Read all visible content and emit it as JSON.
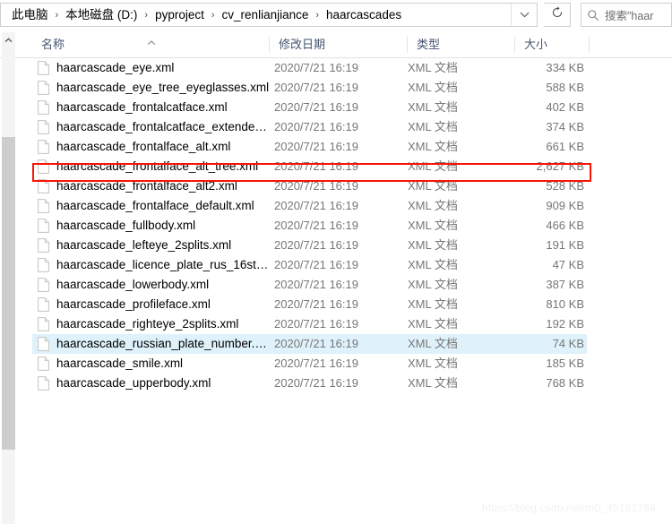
{
  "window": {
    "app": "File Explorer"
  },
  "addressbar": {
    "crumbs": [
      "此电脑",
      "本地磁盘 (D:)",
      "pyproject",
      "cv_renlianjiance",
      "haarcascades"
    ],
    "separator": "›",
    "dropdown_icon": "chevron-down-icon",
    "refresh_icon": "refresh-icon"
  },
  "search": {
    "icon": "search-icon",
    "value": "搜索\"haar"
  },
  "columns": {
    "headers": [
      "名称",
      "修改日期",
      "类型",
      "大小"
    ],
    "sorted_by": "名称",
    "sort_direction": "ascending",
    "sort_icon": "caret-up-icon"
  },
  "scrollbar": {
    "up_icon": "caret-up-icon",
    "orientation": "vertical"
  },
  "annotation": {
    "color": "#fb1304",
    "target_row_index": 5
  },
  "watermark": {
    "text": "https://blog.csdn.net/m0_45161766"
  },
  "files": [
    {
      "icon": "xml-file-icon",
      "name": "haarcascade_eye.xml",
      "date": "2020/7/21 16:19",
      "type": "XML 文档",
      "size": "334 KB",
      "hovered": false
    },
    {
      "icon": "xml-file-icon",
      "name": "haarcascade_eye_tree_eyeglasses.xml",
      "date": "2020/7/21 16:19",
      "type": "XML 文档",
      "size": "588 KB",
      "hovered": false
    },
    {
      "icon": "xml-file-icon",
      "name": "haarcascade_frontalcatface.xml",
      "date": "2020/7/21 16:19",
      "type": "XML 文档",
      "size": "402 KB",
      "hovered": false
    },
    {
      "icon": "xml-file-icon",
      "name": "haarcascade_frontalcatface_extende…",
      "date": "2020/7/21 16:19",
      "type": "XML 文档",
      "size": "374 KB",
      "hovered": false
    },
    {
      "icon": "xml-file-icon",
      "name": "haarcascade_frontalface_alt.xml",
      "date": "2020/7/21 16:19",
      "type": "XML 文档",
      "size": "661 KB",
      "hovered": false
    },
    {
      "icon": "xml-file-icon",
      "name": "haarcascade_frontalface_alt_tree.xml",
      "date": "2020/7/21 16:19",
      "type": "XML 文档",
      "size": "2,627 KB",
      "hovered": false
    },
    {
      "icon": "xml-file-icon",
      "name": "haarcascade_frontalface_alt2.xml",
      "date": "2020/7/21 16:19",
      "type": "XML 文档",
      "size": "528 KB",
      "hovered": false
    },
    {
      "icon": "xml-file-icon",
      "name": "haarcascade_frontalface_default.xml",
      "date": "2020/7/21 16:19",
      "type": "XML 文档",
      "size": "909 KB",
      "hovered": false
    },
    {
      "icon": "xml-file-icon",
      "name": "haarcascade_fullbody.xml",
      "date": "2020/7/21 16:19",
      "type": "XML 文档",
      "size": "466 KB",
      "hovered": false
    },
    {
      "icon": "xml-file-icon",
      "name": "haarcascade_lefteye_2splits.xml",
      "date": "2020/7/21 16:19",
      "type": "XML 文档",
      "size": "191 KB",
      "hovered": false
    },
    {
      "icon": "xml-file-icon",
      "name": "haarcascade_licence_plate_rus_16sta…",
      "date": "2020/7/21 16:19",
      "type": "XML 文档",
      "size": "47 KB",
      "hovered": false
    },
    {
      "icon": "xml-file-icon",
      "name": "haarcascade_lowerbody.xml",
      "date": "2020/7/21 16:19",
      "type": "XML 文档",
      "size": "387 KB",
      "hovered": false
    },
    {
      "icon": "xml-file-icon",
      "name": "haarcascade_profileface.xml",
      "date": "2020/7/21 16:19",
      "type": "XML 文档",
      "size": "810 KB",
      "hovered": false
    },
    {
      "icon": "xml-file-icon",
      "name": "haarcascade_righteye_2splits.xml",
      "date": "2020/7/21 16:19",
      "type": "XML 文档",
      "size": "192 KB",
      "hovered": false
    },
    {
      "icon": "xml-file-icon",
      "name": "haarcascade_russian_plate_number.x…",
      "date": "2020/7/21 16:19",
      "type": "XML 文档",
      "size": "74 KB",
      "hovered": true
    },
    {
      "icon": "xml-file-icon",
      "name": "haarcascade_smile.xml",
      "date": "2020/7/21 16:19",
      "type": "XML 文档",
      "size": "185 KB",
      "hovered": false
    },
    {
      "icon": "xml-file-icon",
      "name": "haarcascade_upperbody.xml",
      "date": "2020/7/21 16:19",
      "type": "XML 文档",
      "size": "768 KB",
      "hovered": false
    }
  ]
}
